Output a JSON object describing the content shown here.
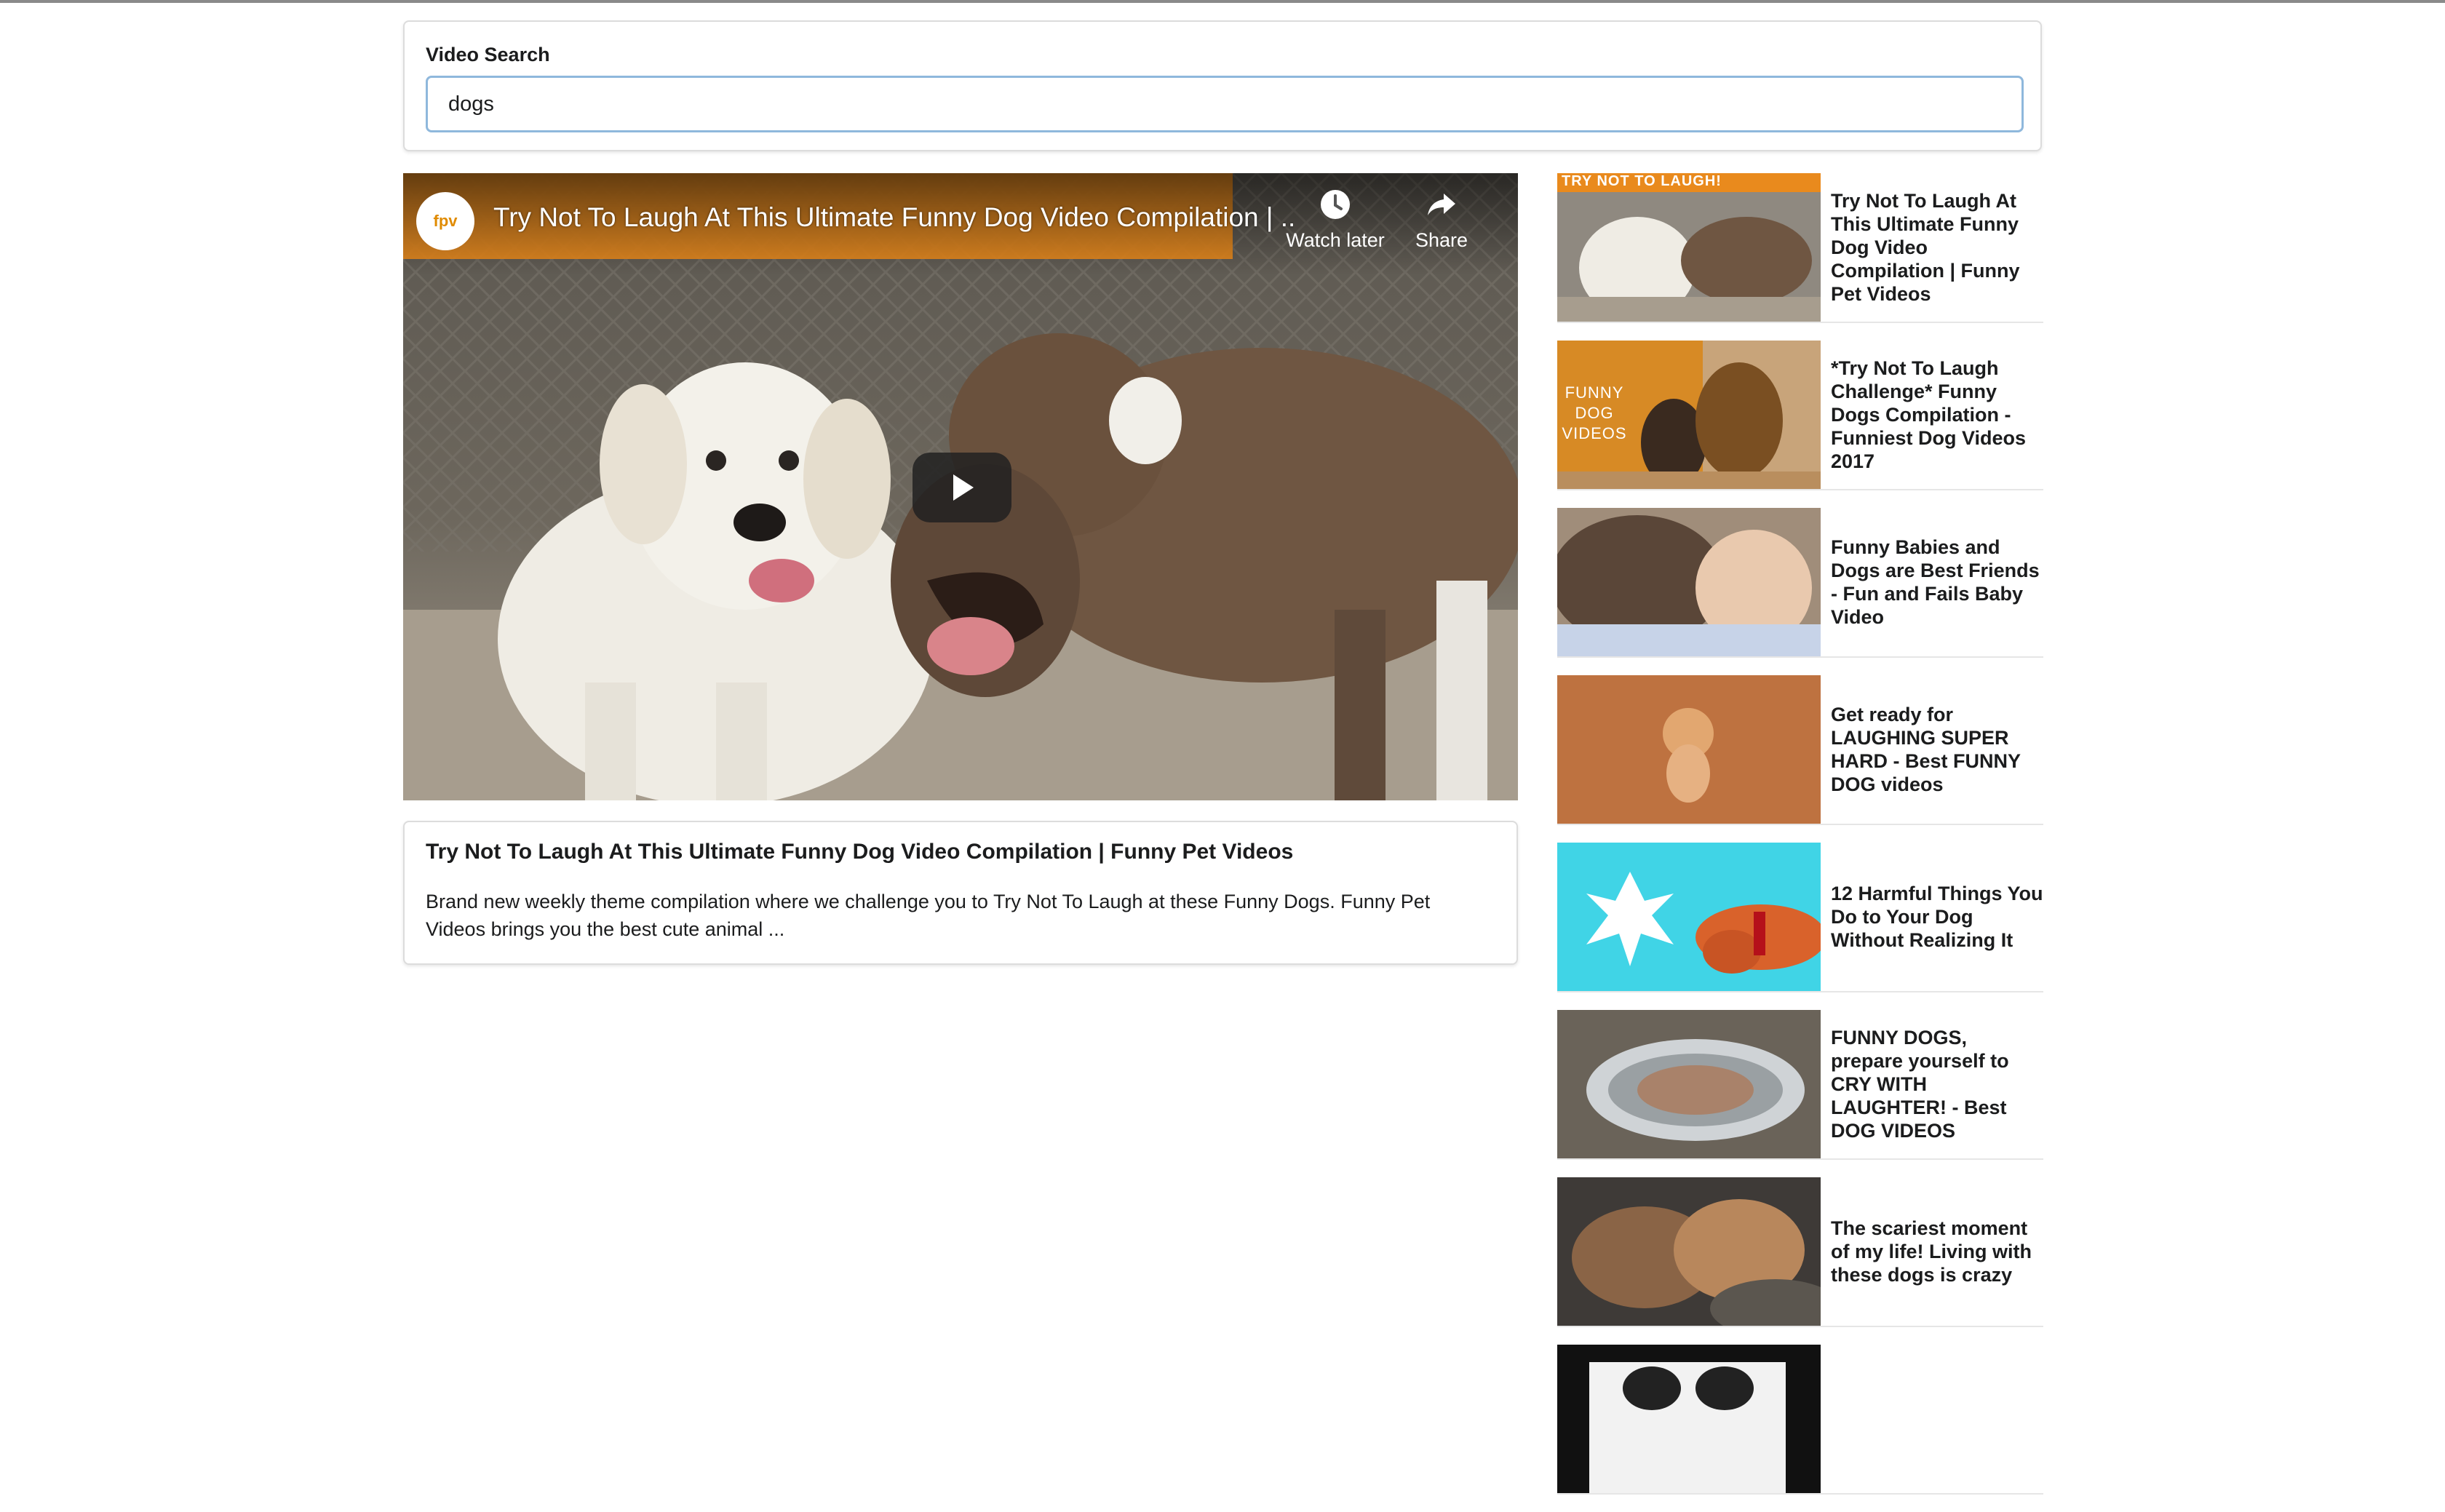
{
  "search": {
    "label": "Video Search",
    "value": "dogs"
  },
  "player": {
    "channel": "fpv",
    "title": "Try Not To Laugh At This Ultimate Funny Dog Video Compilation | ...",
    "watch_later_label": "Watch later",
    "share_label": "Share",
    "icons": {
      "play": "play-icon",
      "watch_later": "clock-icon",
      "share": "share-icon"
    }
  },
  "selected_video": {
    "title": "Try Not To Laugh At This Ultimate Funny Dog Video Compilation | Funny Pet Videos",
    "description": "Brand new weekly theme compilation where we challenge you to Try Not To Laugh at these Funny Dogs. Funny Pet Videos brings you the best cute animal ..."
  },
  "video_list": [
    {
      "title": "Try Not To Laugh At This Ultimate Funny Dog Video Compilation | Funny Pet Videos",
      "thumb_text": "TRY NOT TO LAUGH!"
    },
    {
      "title": "*Try Not To Laugh Challenge* Funny Dogs Compilation - Funniest Dog Videos 2017",
      "thumb_text": "FUNNY DOG VIDEOS"
    },
    {
      "title": "Funny Babies and Dogs are Best Friends - Fun and Fails Baby Video"
    },
    {
      "title": "Get ready for LAUGHING SUPER HARD - Best FUNNY DOG videos"
    },
    {
      "title": "12 Harmful Things You Do to Your Dog Without Realizing It"
    },
    {
      "title": "FUNNY DOGS, prepare yourself to CRY WITH LAUGHTER! - Best DOG VIDEOS"
    },
    {
      "title": "The scariest moment of my life! Living with these dogs is crazy"
    },
    {
      "title": ""
    }
  ],
  "colors": {
    "input_border": "#8fb8dc",
    "card_border": "#dcdcdc",
    "text": "#1b1c1d"
  }
}
